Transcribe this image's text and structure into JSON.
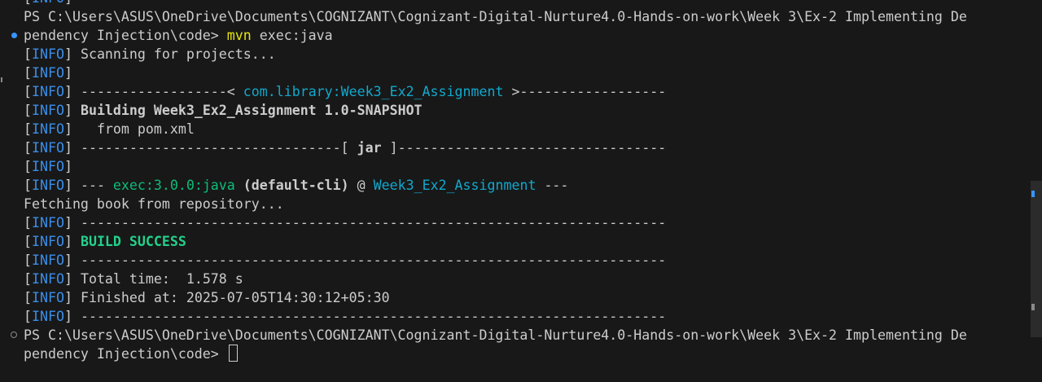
{
  "terminal": {
    "lines": [
      {
        "type": "info",
        "text": ""
      },
      {
        "type": "prompt_path",
        "text": "PS C:\\Users\\ASUS\\OneDrive\\Documents\\COGNIZANT\\Cognizant-Digital-Nurture4.0-Hands-on-work\\Week 3\\Ex-2 Implementing De"
      },
      {
        "type": "prompt_cmd",
        "path": "pendency Injection\\code> ",
        "command": "mvn",
        "args": " exec:java"
      },
      {
        "type": "info",
        "text": " Scanning for projects..."
      },
      {
        "type": "info",
        "text": ""
      },
      {
        "type": "info_artifact",
        "pre": " ------------------< ",
        "artifact": "com.library:Week3_Ex2_Assignment",
        "post": " >------------------"
      },
      {
        "type": "info_bold",
        "text": " Building Week3_Ex2_Assignment 1.0-SNAPSHOT"
      },
      {
        "type": "info",
        "text": "   from pom.xml"
      },
      {
        "type": "info_jar",
        "pre": " --------------------------------[ ",
        "jar": "jar",
        "post": " ]---------------------------------"
      },
      {
        "type": "info",
        "text": ""
      },
      {
        "type": "info_exec",
        "pre": " --- ",
        "plugin": "exec:3.0.0:java",
        "goal": " (default-cli)",
        "at": " @ ",
        "project": "Week3_Ex2_Assignment",
        "post": " ---"
      },
      {
        "type": "plain",
        "text": "Fetching book from repository..."
      },
      {
        "type": "info",
        "text": " ------------------------------------------------------------------------"
      },
      {
        "type": "info_success",
        "text": " BUILD SUCCESS"
      },
      {
        "type": "info",
        "text": " ------------------------------------------------------------------------"
      },
      {
        "type": "info",
        "text": " Total time:  1.578 s"
      },
      {
        "type": "info",
        "text": " Finished at: 2025-07-05T14:30:12+05:30"
      },
      {
        "type": "info",
        "text": " ------------------------------------------------------------------------"
      },
      {
        "type": "prompt_path",
        "text": "PS C:\\Users\\ASUS\\OneDrive\\Documents\\COGNIZANT\\Cognizant-Digital-Nurture4.0-Hands-on-work\\Week 3\\Ex-2 Implementing De"
      },
      {
        "type": "prompt_final",
        "path": "pendency Injection\\code> "
      }
    ],
    "info_open": "[",
    "info_word": "INFO",
    "info_close": "]"
  },
  "colors": {
    "background": "#181818",
    "text": "#cccccc",
    "info": "#3b8eea",
    "artifact": "#11a8cd",
    "success": "#23d18b",
    "command": "#e5e510"
  },
  "icons": [
    "command-success-dot-icon",
    "command-pending-circle-icon"
  ]
}
